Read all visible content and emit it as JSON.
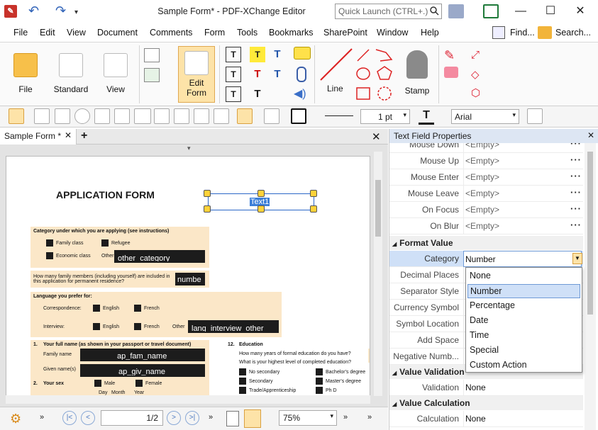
{
  "window": {
    "title": "Sample Form* - PDF-XChange Editor",
    "quick_launch_placeholder": "Quick Launch (CTRL+.)",
    "find": "Find...",
    "search": "Search..."
  },
  "menu": [
    "File",
    "Edit",
    "View",
    "Document",
    "Comments",
    "Form",
    "Tools",
    "Bookmarks",
    "SharePoint",
    "Window",
    "Help"
  ],
  "ribbon": {
    "file": "File",
    "standard": "Standard",
    "view": "View",
    "edit_form_1": "Edit",
    "edit_form_2": "Form",
    "line": "Line",
    "stamp": "Stamp"
  },
  "toolbar2": {
    "line_width": "1 pt",
    "font": "Arial"
  },
  "doc": {
    "tab": "Sample Form *",
    "title": "APPLICATION FORM",
    "selected_field": "Text1",
    "category_heading": "Category under which you are applying (see instructions)",
    "family_class": "Family class",
    "refugee": "Refugee",
    "economic_class": "Economic class",
    "other": "Other",
    "other_field": "other_category",
    "members_q": "How many family members (including yourself) are included in this application for permanent residence?",
    "members_field": "numbe",
    "language_heading": "Language you prefer for:",
    "correspondence": "Correspondence:",
    "english": "English",
    "french": "French",
    "interview": "Interview:",
    "interview_other": "Other",
    "interview_field": "lang_interview_other",
    "full_name": "Your full name (as shown in your passport or travel document)",
    "family_name": "Family name",
    "family_field": "ap_fam_name",
    "given_names": "Given name(s)",
    "given_field": "ap_giv_name",
    "sex": "Your sex",
    "male": "Male",
    "female": "Female",
    "day": "Day",
    "month": "Month",
    "year": "Year",
    "edu_num": "12.",
    "education": "Education",
    "edu_q1": "How many years of formal education do you have?",
    "edu_q2": "What is your highest level of completed education?",
    "no_secondary": "No secondary",
    "bachelors": "Bachelor's degree",
    "secondary": "Secondary",
    "masters": "Master's degree",
    "trade": "Trade/Apprenticeship",
    "phd": "Ph D",
    "num1": "1.",
    "num2": "2."
  },
  "status": {
    "page": "1/2",
    "zoom": "75%"
  },
  "panel": {
    "title": "Text Field Properties",
    "rows_top": [
      {
        "label": "Mouse Down",
        "value": "<Empty>"
      },
      {
        "label": "Mouse Up",
        "value": "<Empty>"
      },
      {
        "label": "Mouse Enter",
        "value": "<Empty>"
      },
      {
        "label": "Mouse Leave",
        "value": "<Empty>"
      },
      {
        "label": "On Focus",
        "value": "<Empty>"
      },
      {
        "label": "On Blur",
        "value": "<Empty>"
      }
    ],
    "group_format": "Format Value",
    "category_label": "Category",
    "category_value": "Number",
    "rows_format": [
      {
        "label": "Decimal Places"
      },
      {
        "label": "Separator Style"
      },
      {
        "label": "Currency Symbol"
      },
      {
        "label": "Symbol Location"
      },
      {
        "label": "Add Space"
      },
      {
        "label": "Negative Numb..."
      }
    ],
    "group_validation": "Value Validation",
    "validation_label": "Validation",
    "validation_value": "None",
    "group_calc": "Value Calculation",
    "calc_label": "Calculation",
    "calc_value": "None",
    "dropdown": [
      "None",
      "Number",
      "Percentage",
      "Date",
      "Time",
      "Special",
      "Custom Action"
    ],
    "dropdown_selected": "Number"
  }
}
